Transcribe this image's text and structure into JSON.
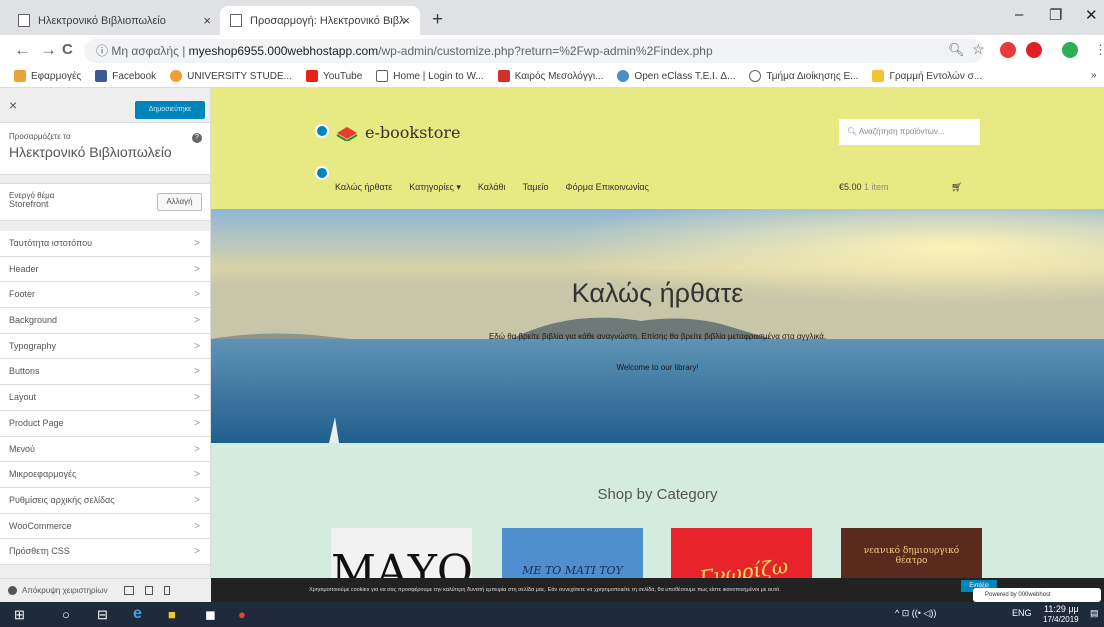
{
  "browser": {
    "tabs": [
      {
        "title": "Ηλεκτρονικό Βιβλιοπωλείο",
        "close": "×"
      },
      {
        "title": "Προσαρμογή: Ηλεκτρονικό Βιβλ",
        "close": "×"
      }
    ],
    "new_tab": "+",
    "window_controls": {
      "minimize": "–",
      "maximize": "❐",
      "close": "✕"
    },
    "nav": {
      "back": "←",
      "forward": "→",
      "reload": "C"
    },
    "address": {
      "security": "ⓘ Μη ασφαλής",
      "separator": "|",
      "host": "myeshop6955.000webhostapp.com",
      "path": "/wp-admin/customize.php?return=%2Fwp-admin%2Findex.php"
    },
    "bookmarks": [
      {
        "label": "Εφαρμογές",
        "icon": "apps-icon",
        "color": "#e8a33a"
      },
      {
        "label": "Facebook",
        "icon": "facebook-icon",
        "color": "#3b5998"
      },
      {
        "label": "UNIVERSITY STUDE...",
        "icon": "university-icon",
        "color": "#f0a030"
      },
      {
        "label": "YouTube",
        "icon": "youtube-icon",
        "color": "#e62117"
      },
      {
        "label": "Home | Login to W...",
        "icon": "page-icon",
        "color": "#ffffff"
      },
      {
        "label": "Καιρός Μεσολόγγι...",
        "icon": "weather-icon",
        "color": "#d32f2f"
      },
      {
        "label": "Open eClass T.E.I. Δ...",
        "icon": "eclass-icon",
        "color": "#4a90c8"
      },
      {
        "label": "Τμήμα Διοίκησης Ε...",
        "icon": "circle-icon",
        "color": "#ffffff"
      },
      {
        "label": "Γραμμή Εντολών σ...",
        "icon": "folder-icon",
        "color": "#f4c430"
      }
    ],
    "bookmarks_more": "»"
  },
  "customizer": {
    "close": "×",
    "publish": "Δημοσιεύτηκε",
    "customizing_label": "Προσαρμόζετε το",
    "site_title": "Ηλεκτρονικό Βιβλιοπωλείο",
    "help": "?",
    "active_theme_label": "Ενεργό θέμα",
    "active_theme": "Storefront",
    "change_button": "Αλλαγή",
    "menu": [
      "Ταυτότητα ιστοτόπου",
      "Header",
      "Footer",
      "Background",
      "Typography",
      "Buttons",
      "Layout",
      "Product Page",
      "Μενού",
      "Μικροεφαρμογές",
      "Ρυθμίσεις αρχικής σελίδας",
      "WooCommerce",
      "Πρόσθετη CSS"
    ],
    "chevron": ">",
    "hide_controls": "Απόκρυψη χειριστηρίων"
  },
  "site": {
    "brand": "e-bookstore",
    "search_placeholder": "Αναζήτηση προϊόντων...",
    "nav": [
      "Καλώς ήρθατε",
      "Κατηγορίες ▾",
      "Καλάθι",
      "Ταμείο",
      "Φόρμα Επικοινωνίας"
    ],
    "cart_total": "€5.00",
    "cart_items": "1 item",
    "hero_title": "Καλώς ήρθατε",
    "hero_subtitle": "Εδώ θα βρείτε βιβλία για κάθε αναγνώστη. Επίσης θα βρείτε βιβλία μεταφρασμένα στα αγγλικά.",
    "hero_welcome": "Welcome to our library!",
    "shop_title": "Shop by Category",
    "books": [
      {
        "text": "ΜΑΥΟ",
        "bg": "#f2f2f2",
        "fg": "#111"
      },
      {
        "text": "ΜΕ ΤΟ ΜΑΤΙ ΤΟΥ ΣΤΑΘΙΟΓΡΑΦΟΥ",
        "bg": "#4f8fcf",
        "fg": "#1a2f55"
      },
      {
        "text": "Γνωρίζω",
        "bg": "#e8232a",
        "fg": "#f7e36a"
      },
      {
        "text": "νεανικό δημιουργικό θέατρο",
        "bg": "#5a2a1f",
        "fg": "#f0d080"
      }
    ],
    "cookie_text": "Χρησιμοποιούμε cookies για να σας προσφέρουμε την καλύτερη δυνατή εμπειρία στη σελίδα μας. Εάν συνεχίσετε να χρησιμοποιείτε τη σελίδα, θα υποθέσουμε πως είστε ικανοποιημένοι με αυτό.",
    "cookie_ok": "Εντάξει",
    "powered": "Powered by 000webhost"
  },
  "taskbar": {
    "time": "11:29 μμ",
    "date": "17/4/2019",
    "lang": "ENG",
    "tray": "^ ⊡ ((• ◁))"
  }
}
